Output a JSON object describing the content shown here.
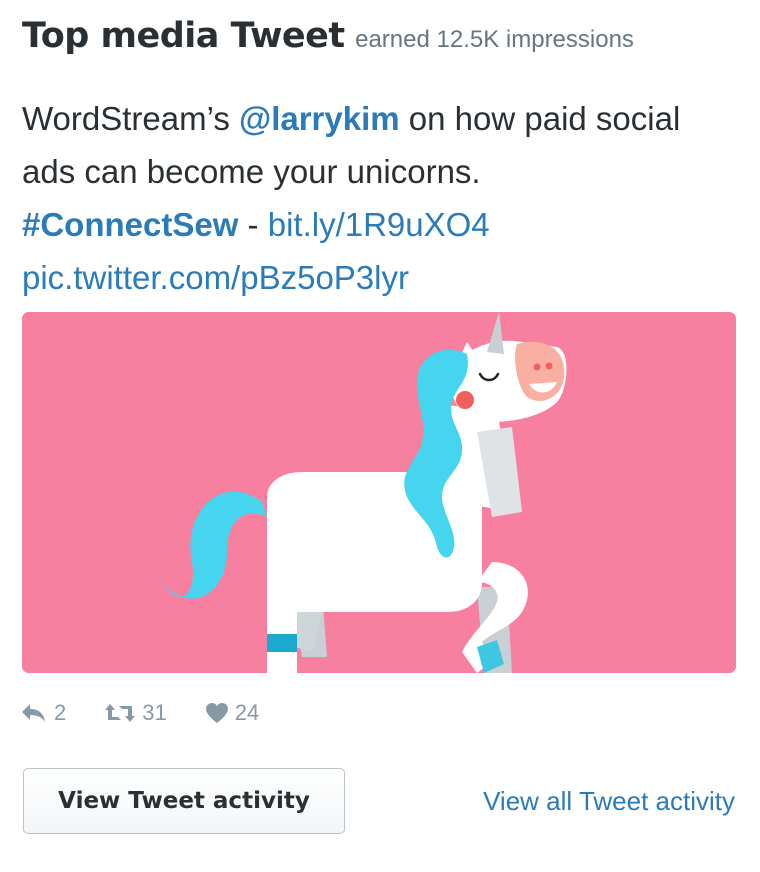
{
  "header": {
    "title": "Top media Tweet",
    "impressions": "earned 12.5K impressions"
  },
  "tweet": {
    "prefix": "WordStream’s ",
    "mention": "@larrykim",
    "middle": " on how paid social ads can become your unicorns.",
    "hashtag": "#ConnectSew",
    "separator": " - ",
    "short_link": "bit.ly/1R9uXO4",
    "pic_link": "pic.twitter.com/pBz5oP3lyr"
  },
  "media": {
    "background_color": "#f77f9f",
    "subject": "unicorn-illustration"
  },
  "actions": {
    "replies": "2",
    "retweets": "31",
    "likes": "24"
  },
  "buttons": {
    "view_activity": "View Tweet activity",
    "view_all_activity": "View all Tweet activity"
  },
  "colors": {
    "link": "#2b7bb9",
    "text": "#292f33",
    "muted": "#8899a6"
  }
}
